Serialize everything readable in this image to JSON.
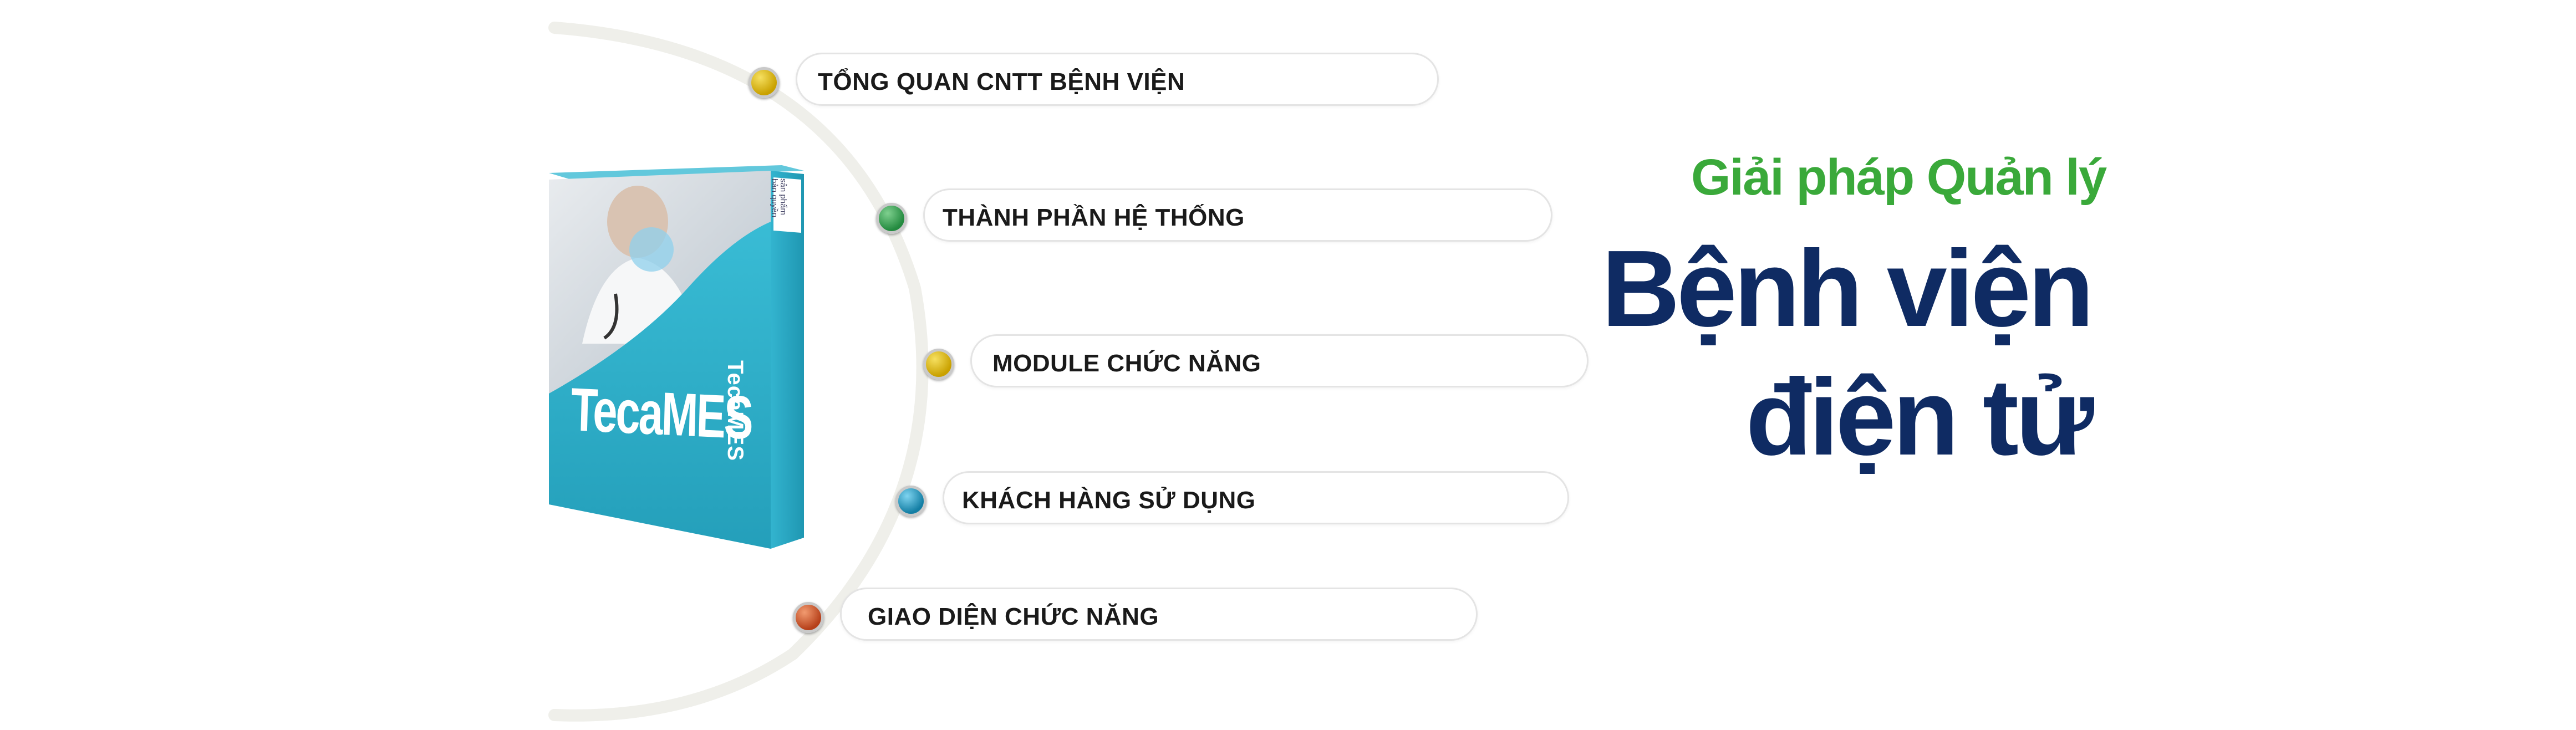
{
  "product": {
    "brand": "TecaMES",
    "spine_tag_line1": "sản phẩm",
    "spine_tag_line2": "bản quyền"
  },
  "menu": [
    {
      "label": "TỔNG QUAN CNTT BỆNH VIỆN",
      "dot_color": "#d4b000"
    },
    {
      "label": "THÀNH PHẦN HỆ THỐNG",
      "dot_color": "#2e9a4c"
    },
    {
      "label": "MODULE CHỨC NĂNG",
      "dot_color": "#d4b000"
    },
    {
      "label": "KHÁCH HÀNG SỬ DỤNG",
      "dot_color": "#1e92b8"
    },
    {
      "label": "GIAO DIỆN CHỨC NĂNG",
      "dot_color": "#d2542a"
    }
  ],
  "headline": {
    "subtitle": "Giải pháp Quản lý",
    "title_line1": "Bệnh viện",
    "title_line2": "điện tử"
  },
  "colors": {
    "subtitle": "#3aa93a",
    "title": "#0f2b63",
    "box_teal": "#2fb1cb"
  }
}
